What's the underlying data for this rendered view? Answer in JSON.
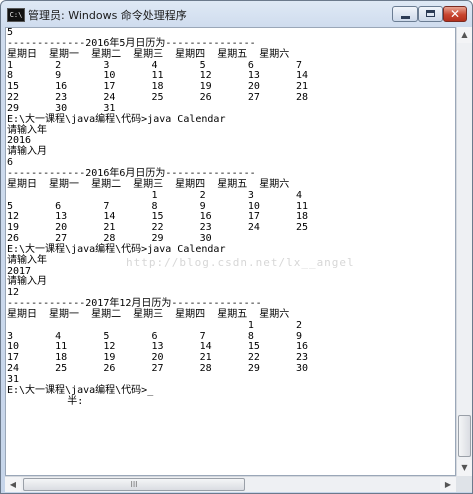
{
  "window": {
    "icon_text": "C:\\",
    "title": "管理员: Windows 命令处理程序",
    "min_symbol": "",
    "max_symbol": "",
    "close_symbol": "✕"
  },
  "console": {
    "lines": [
      "5",
      "-------------2016年5月日历为---------------",
      "星期日  星期一  星期二  星期三  星期四  星期五  星期六",
      "1       2       3       4       5       6       7",
      "8       9       10      11      12      13      14",
      "15      16      17      18      19      20      21",
      "22      23      24      25      26      27      28",
      "29      30      31",
      "E:\\大一课程\\java编程\\代码>java Calendar",
      "请输入年",
      "2016",
      "请输入月",
      "6",
      "-------------2016年6月日历为---------------",
      "星期日  星期一  星期二  星期三  星期四  星期五  星期六",
      "                        1       2       3       4",
      "5       6       7       8       9       10      11",
      "12      13      14      15      16      17      18",
      "19      20      21      22      23      24      25",
      "26      27      28      29      30",
      "E:\\大一课程\\java编程\\代码>java Calendar",
      "请输入年",
      "2017",
      "请输入月",
      "12",
      "-------------2017年12月日历为---------------",
      "星期日  星期一  星期二  星期三  星期四  星期五  星期六",
      "                                        1       2",
      "3       4       5       6       7       8       9",
      "10      11      12      13      14      15      16",
      "17      18      19      20      21      22      23",
      "24      25      26      27      28      29      30",
      "31",
      "E:\\大一课程\\java编程\\代码>_",
      "          半:"
    ],
    "watermark": "http://blog.csdn.net/lx__angel"
  },
  "scrollbars": {
    "up_arrow": "▲",
    "down_arrow": "▼",
    "left_arrow": "◀",
    "right_arrow": "▶",
    "h_thumb_grip": "III"
  }
}
